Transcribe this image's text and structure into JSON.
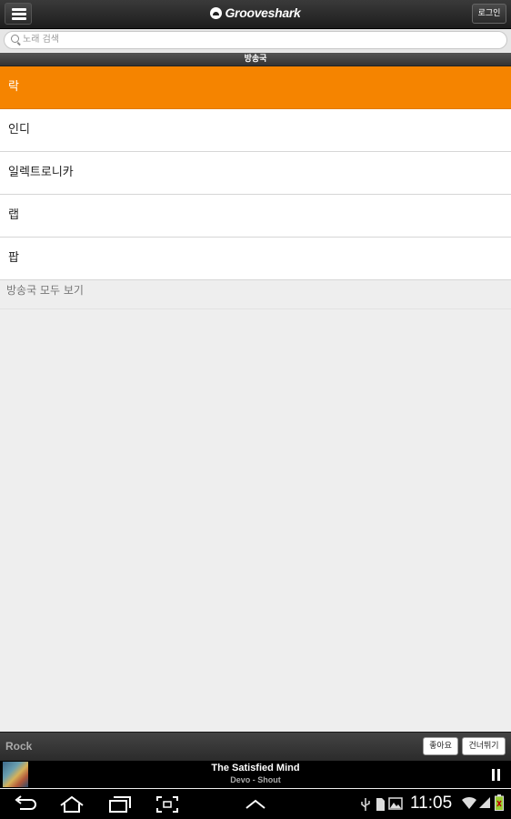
{
  "header": {
    "logo_text": "Grooveshark",
    "login_label": "로그인"
  },
  "search": {
    "placeholder": "노래 검색"
  },
  "section": {
    "title": "방송국"
  },
  "stations": [
    {
      "label": "락",
      "selected": true
    },
    {
      "label": "인디",
      "selected": false
    },
    {
      "label": "일렉트로니카",
      "selected": false
    },
    {
      "label": "랩",
      "selected": false
    },
    {
      "label": "팝",
      "selected": false
    }
  ],
  "view_all_label": "방송국 모두 보기",
  "player": {
    "station_name": "Rock",
    "like_label": "좋아요",
    "skip_label": "건너뛰기",
    "track_title": "The Satisfied Mind",
    "track_artist_album": "Devo - Shout"
  },
  "system": {
    "time": "11:05"
  },
  "colors": {
    "accent": "#f58400",
    "bar_dark": "#2b2b2b"
  }
}
